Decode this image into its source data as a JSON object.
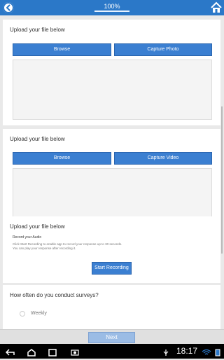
{
  "header": {
    "progress_text": "100%",
    "progress_fraction": 1.0,
    "back_icon": "back-circle-icon",
    "home_icon": "home-icon"
  },
  "cards": {
    "photo": {
      "title": "Upload your file below",
      "browse_label": "Browse",
      "capture_label": "Capture Photo"
    },
    "video": {
      "title": "Upload your file below",
      "browse_label": "Browse",
      "capture_label": "Capture Video"
    },
    "audio": {
      "title": "Upload your file below",
      "record_label": "Record your Audio",
      "line1": "Click Start Recording to enable app to record your response up to 30 seconds.",
      "line2": "You can play your response after recording it.",
      "button_label": "Start Recording"
    },
    "survey": {
      "question": "How often do you conduct surveys?",
      "option_1": "Weekly"
    }
  },
  "footer": {
    "next_label": "Next"
  },
  "system_bar": {
    "clock": "18:17",
    "accent": "#2b78c8"
  }
}
